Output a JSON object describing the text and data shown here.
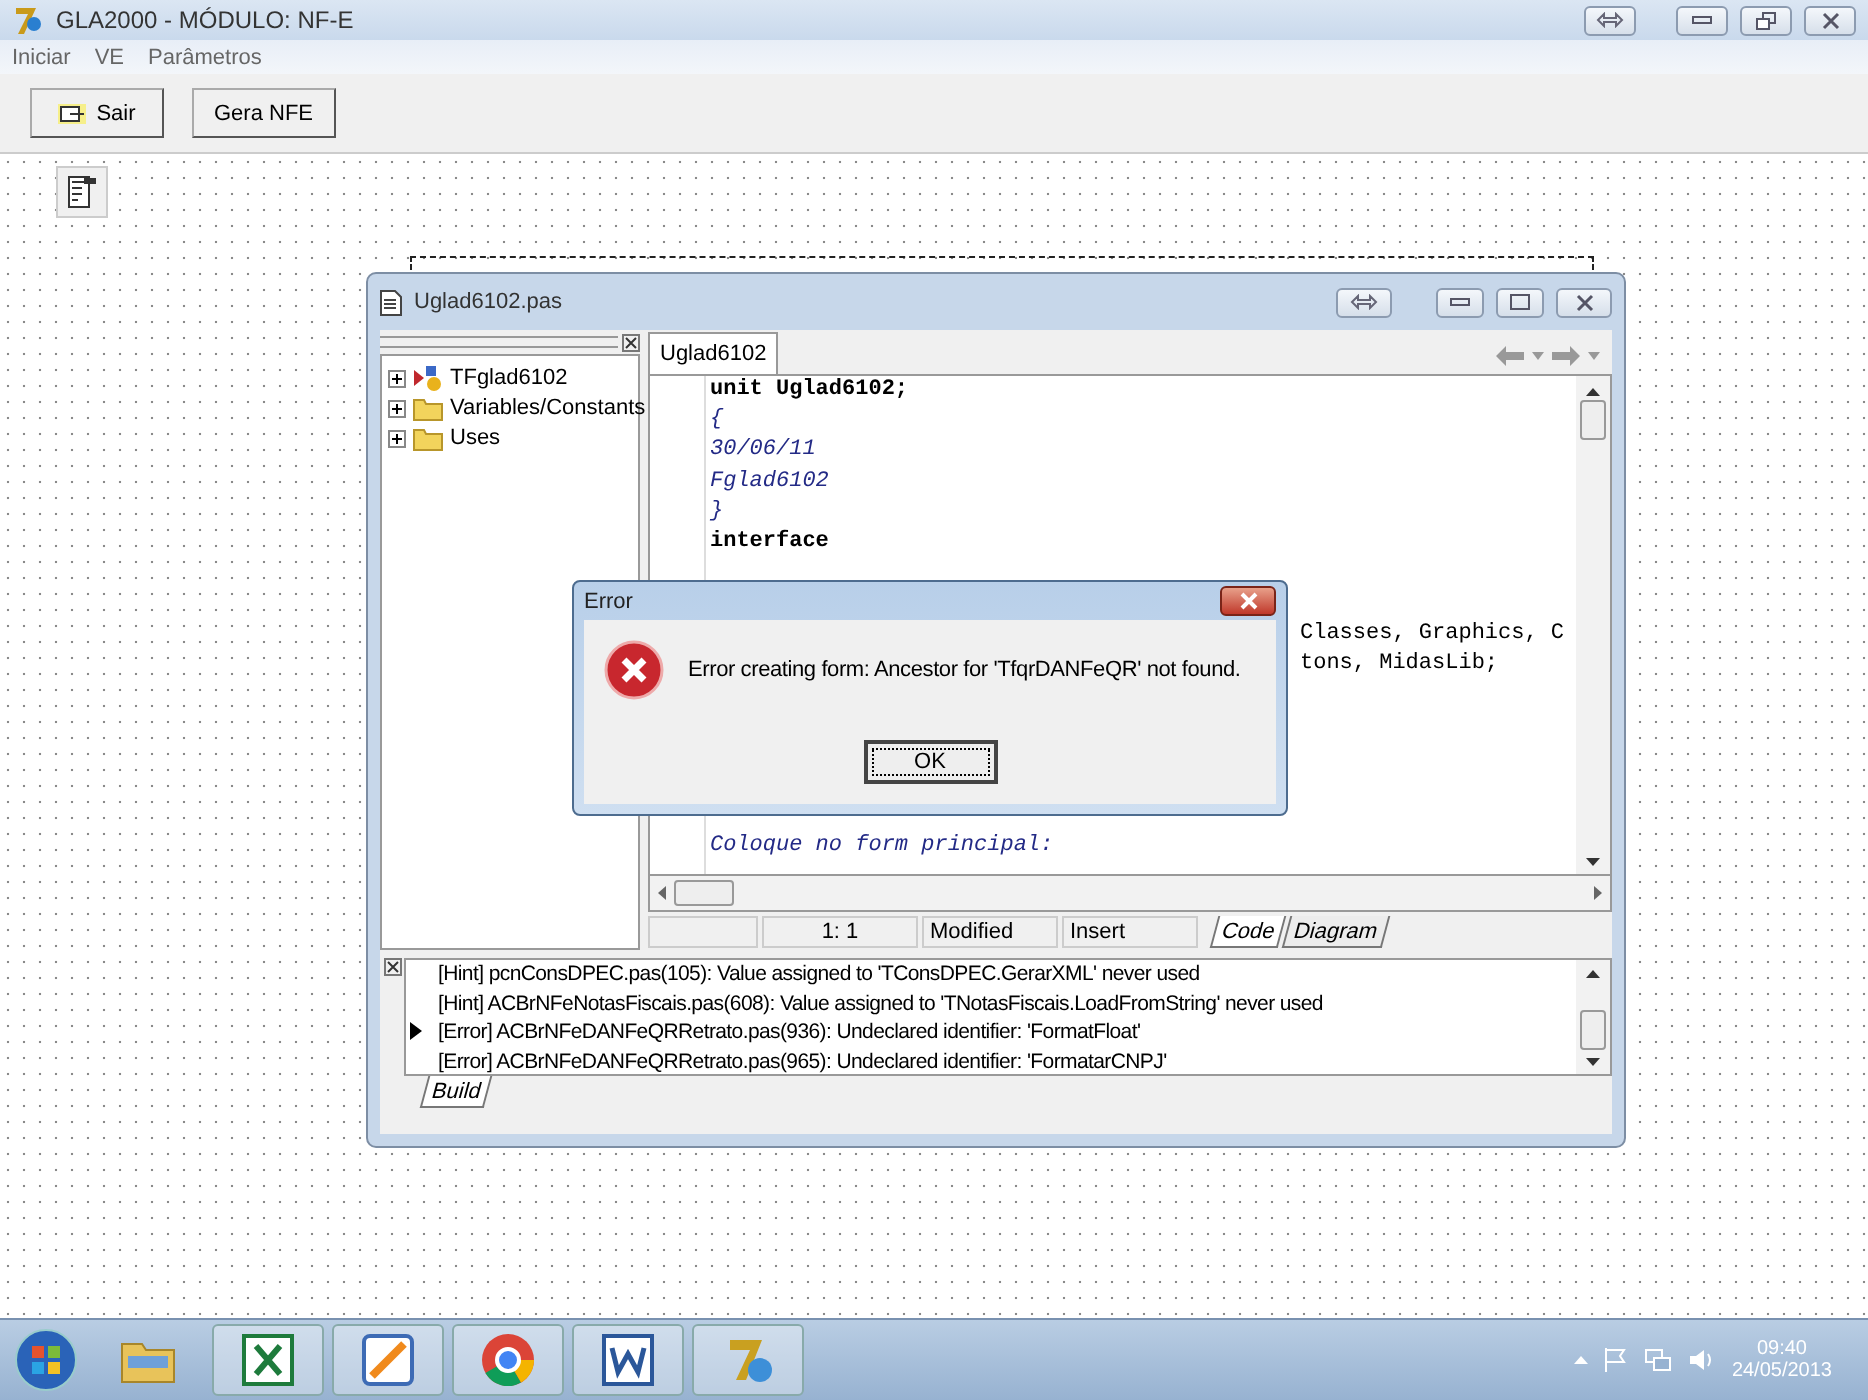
{
  "window": {
    "title": "GLA2000 - MÓDULO: NF-E"
  },
  "menu": [
    "Iniciar",
    "VE",
    "Parâmetros"
  ],
  "toolbar": [
    {
      "label": "Sair",
      "kind": "exit"
    },
    {
      "label": "Gera NFE",
      "kind": "plain"
    }
  ],
  "editor": {
    "title": "Uglad6102.pas",
    "tree": [
      {
        "label": "TFglad6102",
        "kind": "class",
        "expanded": false
      },
      {
        "label": "Variables/Constants",
        "kind": "folder",
        "expanded": false
      },
      {
        "label": "Uses",
        "kind": "folder",
        "expanded": false
      }
    ],
    "tabs": [
      {
        "label": "Uglad6102",
        "selected": true
      }
    ],
    "code": [
      {
        "kind": "keyword",
        "text": "unit Uglad6102;"
      },
      {
        "kind": "comment",
        "text": "{"
      },
      {
        "kind": "comment",
        "text": "30/06/11"
      },
      {
        "kind": "comment",
        "text": "Fglad6102"
      },
      {
        "kind": "comment",
        "text": "}"
      },
      {
        "kind": "keyword",
        "text": "interface"
      },
      {
        "kind": "blank"
      },
      {
        "kind": "blank"
      },
      {
        "kind": "covered",
        "text": "Classes, Graphics, C"
      },
      {
        "kind": "covered",
        "text": "tons, MidasLib;"
      },
      {
        "kind": "blank"
      },
      {
        "kind": "blank"
      },
      {
        "kind": "blank"
      },
      {
        "kind": "blank"
      },
      {
        "kind": "blank"
      },
      {
        "kind": "comment",
        "text": "Coloque no form principal:"
      }
    ],
    "status": {
      "position": "1:  1",
      "modified": "Modified",
      "mode": "Insert"
    },
    "view_tabs": [
      {
        "label": "Code",
        "selected": true
      },
      {
        "label": "Diagram",
        "selected": false
      }
    ],
    "messages": [
      {
        "text": "[Hint] pcnConsDPEC.pas(105): Value assigned to 'TConsDPEC.GerarXML' never used",
        "selected": false
      },
      {
        "text": "[Hint] ACBrNFeNotasFiscais.pas(608): Value assigned to 'TNotasFiscais.LoadFromString' never used",
        "selected": false
      },
      {
        "text": "[Error] ACBrNFeDANFeQRRetrato.pas(936): Undeclared identifier: 'FormatFloat'",
        "selected": true
      },
      {
        "text": "[Error] ACBrNFeDANFeQRRetrato.pas(965): Undeclared identifier: 'FormatarCNPJ'",
        "selected": false
      }
    ],
    "message_tabs": [
      {
        "label": "Build",
        "selected": true
      }
    ]
  },
  "dialog": {
    "title": "Error",
    "message": "Error creating form: Ancestor for 'TfqrDANFeQR' not found.",
    "button": "OK"
  },
  "taskbar": {
    "apps": [
      {
        "kind": "folder"
      },
      {
        "kind": "excel"
      },
      {
        "kind": "pen"
      },
      {
        "kind": "chrome"
      },
      {
        "kind": "word"
      },
      {
        "kind": "seven"
      }
    ],
    "time": "09:40",
    "date": "24/05/2013"
  }
}
